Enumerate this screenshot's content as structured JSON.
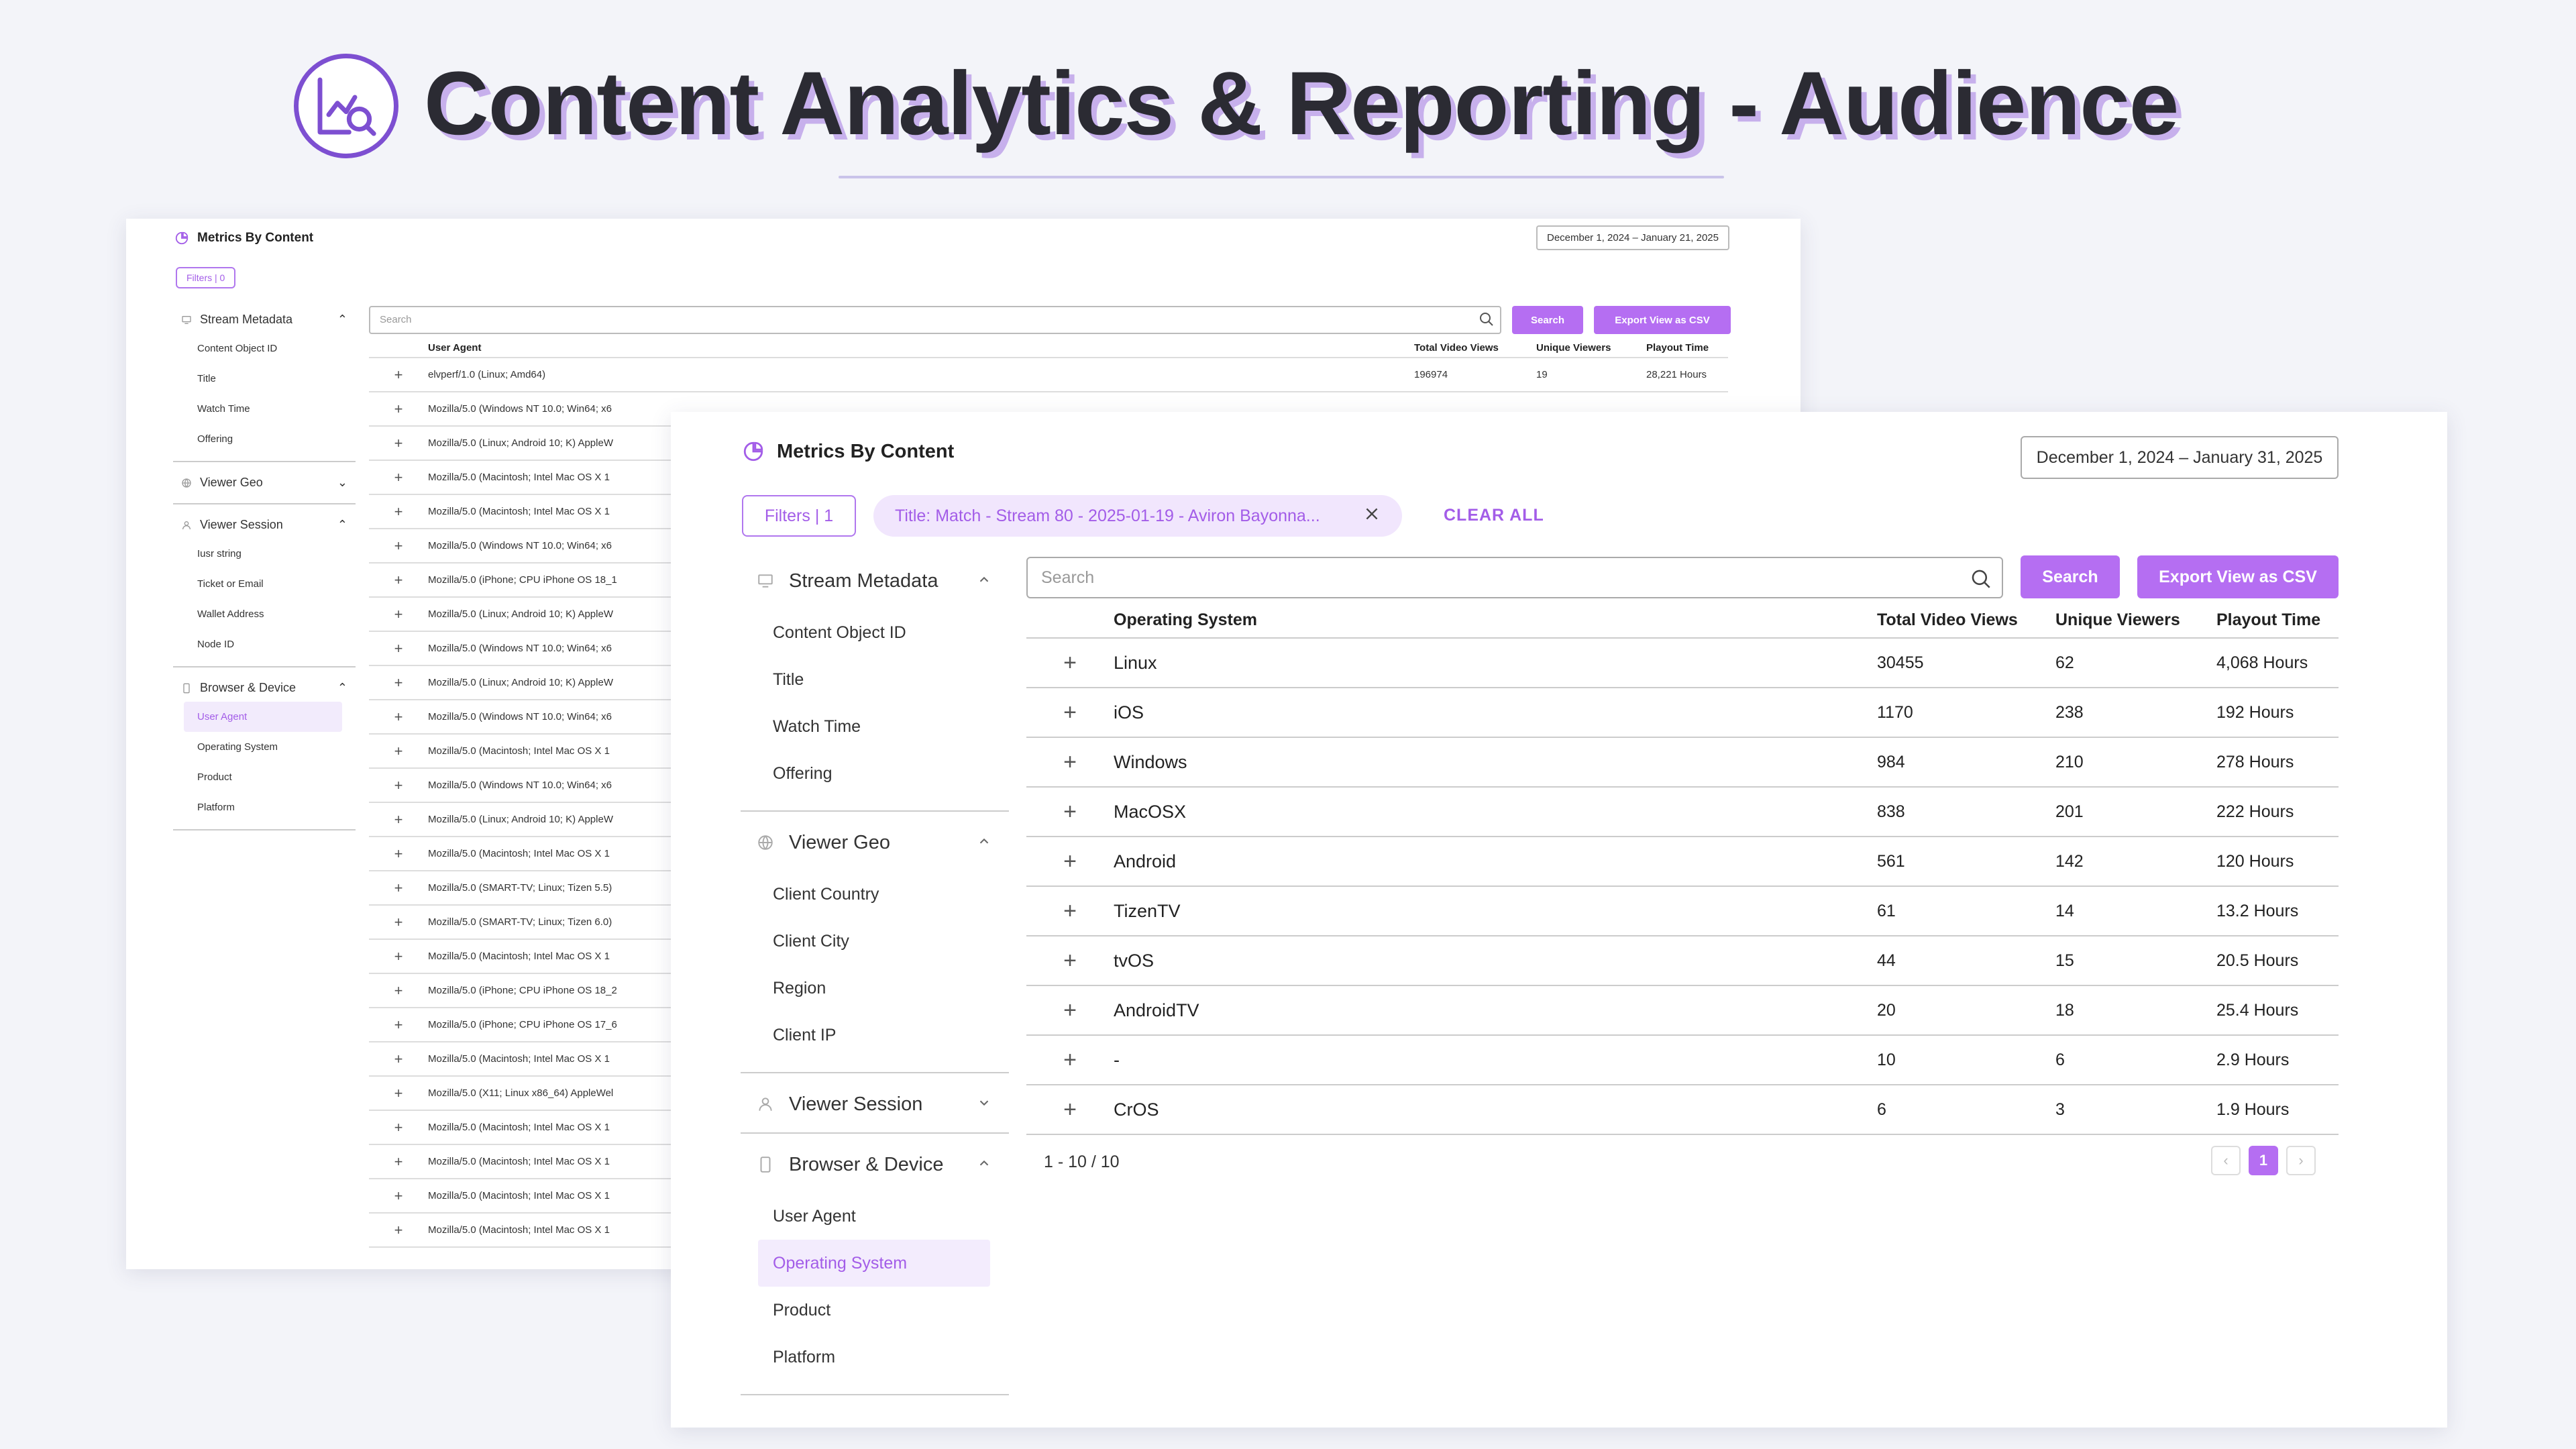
{
  "hero": {
    "title": "Content Analytics & Reporting - Audience",
    "logo_icon": "chart-search-icon"
  },
  "colors": {
    "accent": "#b56ef2",
    "accent_text": "#a35de8",
    "brand_ring": "#7d4fd1"
  },
  "back": {
    "title": "Metrics By Content",
    "date_range": "December 1, 2024 – January 21, 2025",
    "filters_label": "Filters | 0",
    "search_placeholder": "Search",
    "search_button": "Search",
    "export_button": "Export View as CSV",
    "sidebar": {
      "stream_metadata": {
        "label": "Stream Metadata",
        "items": [
          "Content Object ID",
          "Title",
          "Watch Time",
          "Offering"
        ]
      },
      "viewer_geo": {
        "label": "Viewer Geo"
      },
      "viewer_session": {
        "label": "Viewer Session",
        "items": [
          "Iusr string",
          "Ticket or Email",
          "Wallet Address",
          "Node ID"
        ]
      },
      "browser_device": {
        "label": "Browser & Device",
        "items": [
          "User Agent",
          "Operating System",
          "Product",
          "Platform"
        ]
      }
    },
    "table": {
      "headers": [
        "User Agent",
        "Total Video Views",
        "Unique Viewers",
        "Playout Time"
      ],
      "first_row": [
        "elvperf/1.0 (Linux; Amd64)",
        "196974",
        "19",
        "28,221 Hours"
      ],
      "rows": [
        "Mozilla/5.0 (Windows NT 10.0; Win64; x6",
        "Mozilla/5.0 (Linux; Android 10; K) AppleW",
        "Mozilla/5.0 (Macintosh; Intel Mac OS X 1",
        "Mozilla/5.0 (Macintosh; Intel Mac OS X 1",
        "Mozilla/5.0 (Windows NT 10.0; Win64; x6",
        "Mozilla/5.0 (iPhone; CPU iPhone OS 18_1",
        "Mozilla/5.0 (Linux; Android 10; K) AppleW",
        "Mozilla/5.0 (Windows NT 10.0; Win64; x6",
        "Mozilla/5.0 (Linux; Android 10; K) AppleW",
        "Mozilla/5.0 (Windows NT 10.0; Win64; x6",
        "Mozilla/5.0 (Macintosh; Intel Mac OS X 1",
        "Mozilla/5.0 (Windows NT 10.0; Win64; x6",
        "Mozilla/5.0 (Linux; Android 10; K) AppleW",
        "Mozilla/5.0 (Macintosh; Intel Mac OS X 1",
        "Mozilla/5.0 (SMART-TV; Linux; Tizen 5.5)",
        "Mozilla/5.0 (SMART-TV; Linux; Tizen 6.0)",
        "Mozilla/5.0 (Macintosh; Intel Mac OS X 1",
        "Mozilla/5.0 (iPhone; CPU iPhone OS 18_2",
        "Mozilla/5.0 (iPhone; CPU iPhone OS 17_6",
        "Mozilla/5.0 (Macintosh; Intel Mac OS X 1",
        "Mozilla/5.0 (X11; Linux x86_64) AppleWel",
        "Mozilla/5.0 (Macintosh; Intel Mac OS X 1",
        "Mozilla/5.0 (Macintosh; Intel Mac OS X 1",
        "Mozilla/5.0 (Macintosh; Intel Mac OS X 1",
        "Mozilla/5.0 (Macintosh; Intel Mac OS X 1"
      ]
    }
  },
  "front": {
    "title": "Metrics By Content",
    "date_range": "December 1, 2024 – January 31, 2025",
    "filters_label": "Filters | 1",
    "filter_chip": "Title: Match - Stream 80 - 2025-01-19 - Aviron Bayonna...",
    "clear_all": "CLEAR ALL",
    "search_placeholder": "Search",
    "search_button": "Search",
    "export_button": "Export View as CSV",
    "sidebar": {
      "stream_metadata": {
        "label": "Stream Metadata",
        "items": [
          "Content Object ID",
          "Title",
          "Watch Time",
          "Offering"
        ]
      },
      "viewer_geo": {
        "label": "Viewer Geo",
        "items": [
          "Client Country",
          "Client City",
          "Region",
          "Client IP"
        ]
      },
      "viewer_session": {
        "label": "Viewer Session"
      },
      "browser_device": {
        "label": "Browser & Device",
        "items": [
          "User Agent",
          "Operating System",
          "Product",
          "Platform"
        ]
      }
    },
    "table": {
      "headers": [
        "Operating System",
        "Total Video Views",
        "Unique Viewers",
        "Playout Time"
      ],
      "rows": [
        {
          "os": "Linux",
          "views": "30455",
          "uniq": "62",
          "time": "4,068 Hours"
        },
        {
          "os": "iOS",
          "views": "1170",
          "uniq": "238",
          "time": "192 Hours"
        },
        {
          "os": "Windows",
          "views": "984",
          "uniq": "210",
          "time": "278 Hours"
        },
        {
          "os": "MacOSX",
          "views": "838",
          "uniq": "201",
          "time": "222 Hours"
        },
        {
          "os": "Android",
          "views": "561",
          "uniq": "142",
          "time": "120 Hours"
        },
        {
          "os": "TizenTV",
          "views": "61",
          "uniq": "14",
          "time": "13.2 Hours"
        },
        {
          "os": "tvOS",
          "views": "44",
          "uniq": "15",
          "time": "20.5 Hours"
        },
        {
          "os": "AndroidTV",
          "views": "20",
          "uniq": "18",
          "time": "25.4 Hours"
        },
        {
          "os": "-",
          "views": "10",
          "uniq": "6",
          "time": "2.9 Hours"
        },
        {
          "os": "CrOS",
          "views": "6",
          "uniq": "3",
          "time": "1.9 Hours"
        }
      ]
    },
    "pagination": {
      "summary": "1 - 10 / 10",
      "prev": "‹",
      "current": "1",
      "next": "›"
    }
  }
}
